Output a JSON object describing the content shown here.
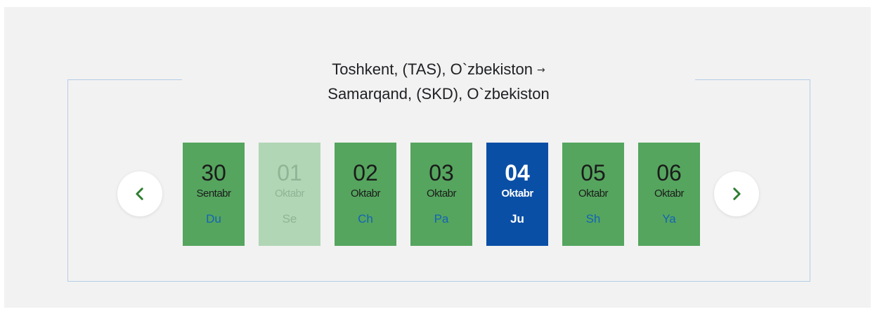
{
  "route": {
    "origin": "Toshkent, (TAS), O`zbekiston",
    "arrow": "→",
    "destination": "Samarqand, (SKD), O`zbekiston"
  },
  "navigation": {
    "prev_icon": "chevron-left-icon",
    "next_icon": "chevron-right-icon",
    "icon_color": "#2e7d32"
  },
  "dates": [
    {
      "day": "30",
      "month": "Sentabr",
      "weekday": "Du",
      "state": "available"
    },
    {
      "day": "01",
      "month": "Oktabr",
      "weekday": "Se",
      "state": "disabled"
    },
    {
      "day": "02",
      "month": "Oktabr",
      "weekday": "Ch",
      "state": "available"
    },
    {
      "day": "03",
      "month": "Oktabr",
      "weekday": "Pa",
      "state": "available"
    },
    {
      "day": "04",
      "month": "Oktabr",
      "weekday": "Ju",
      "state": "selected"
    },
    {
      "day": "05",
      "month": "Oktabr",
      "weekday": "Sh",
      "state": "available"
    },
    {
      "day": "06",
      "month": "Oktabr",
      "weekday": "Ya",
      "state": "available"
    }
  ],
  "colors": {
    "available": "#55a55e",
    "disabled": "#b1d6b5",
    "selected": "#0a4fa6",
    "weekday_text": "#1463b8",
    "border": "#b5cde8"
  }
}
